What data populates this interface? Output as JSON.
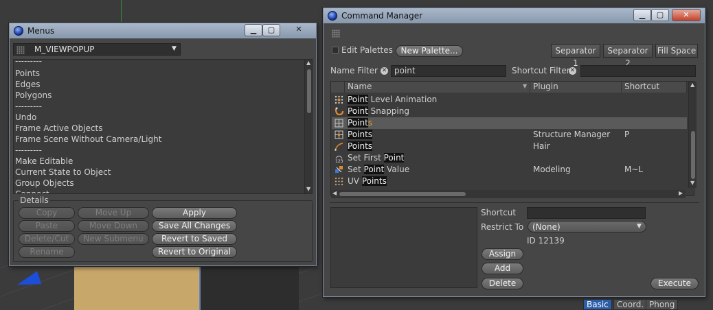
{
  "menus_window": {
    "title": "Menus",
    "dropdown_value": "M_VIEWPOPUP",
    "items": [
      "---------",
      "Points",
      "Edges",
      "Polygons",
      "---------",
      "Undo",
      "Frame Active Objects",
      "Frame Scene Without Camera/Light",
      "---------",
      "Make Editable",
      "Current State to Object",
      "Group Objects",
      "Connect"
    ],
    "details_label": "Details",
    "buttons": {
      "copy": "Copy",
      "move_up": "Move Up",
      "apply": "Apply",
      "paste": "Paste",
      "move_down": "Move Down",
      "save_all": "Save All Changes",
      "delete_cut": "Delete/Cut",
      "new_submenu": "New Submenu",
      "revert_saved": "Revert to Saved",
      "rename": "Rename",
      "revert_original": "Revert to Original"
    }
  },
  "command_manager": {
    "title": "Command Manager",
    "edit_palettes": "Edit Palettes",
    "new_palette": "New Palette...",
    "separator1": "Separator 1",
    "separator2": "Separator 2",
    "fill_space": "Fill Space",
    "name_filter_label": "Name Filter",
    "name_filter_value": "point",
    "shortcut_filter_label": "Shortcut Filter",
    "shortcut_filter_value": "",
    "columns": {
      "name": "Name",
      "plugin": "Plugin",
      "shortcut": "Shortcut"
    },
    "rows": [
      {
        "pre": "",
        "hl": "Point",
        "post": " Level Animation",
        "plugin": "",
        "shortcut": "",
        "icon": "grid-dots-icon"
      },
      {
        "pre": "",
        "hl": "Point",
        "post": " Snapping",
        "plugin": "",
        "shortcut": "",
        "icon": "snap-magnet-icon"
      },
      {
        "pre": "",
        "hl": "Point",
        "post": "s",
        "plugin": "",
        "shortcut": "",
        "icon": "points-mode-icon"
      },
      {
        "pre": "",
        "hl": "Points",
        "post": "",
        "plugin": "Structure Manager",
        "shortcut": "P",
        "icon": "points-mode-icon"
      },
      {
        "pre": "",
        "hl": "Points",
        "post": "",
        "plugin": "Hair",
        "shortcut": "",
        "icon": "hair-curve-icon"
      },
      {
        "pre": "Set First ",
        "hl": "Point",
        "post": "",
        "plugin": "",
        "shortcut": "",
        "icon": "first-point-icon"
      },
      {
        "pre": "Set ",
        "hl": "Point",
        "post": " Value",
        "plugin": "Modeling",
        "shortcut": "M~L",
        "icon": "set-value-icon"
      },
      {
        "pre": "UV ",
        "hl": "Points",
        "post": "",
        "plugin": "",
        "shortcut": "",
        "icon": "uv-points-icon"
      }
    ],
    "shortcut_label": "Shortcut",
    "shortcut_value": "",
    "restrict_to_label": "Restrict To",
    "restrict_to_value": "(None)",
    "id_text": "ID 12139",
    "assign": "Assign",
    "add": "Add",
    "delete": "Delete",
    "execute": "Execute"
  },
  "attribute_tabs": [
    "Basic",
    "Coord.",
    "Phong"
  ]
}
